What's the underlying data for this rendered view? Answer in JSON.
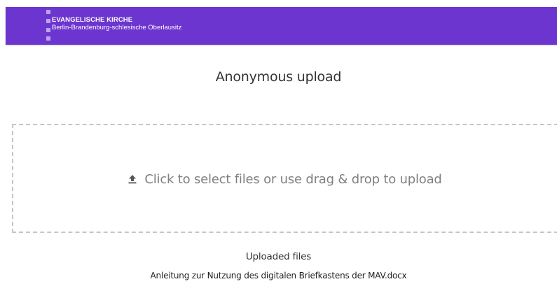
{
  "header": {
    "org_name": "EVANGELISCHE KIRCHE",
    "org_region": "Berlin-Brandenburg-schlesische Oberlausitz",
    "background_color": "#6d35cf"
  },
  "page": {
    "title": "Anonymous upload"
  },
  "dropzone": {
    "icon": "upload-icon",
    "label": "Click to select files or use drag & drop to upload"
  },
  "uploaded": {
    "heading": "Uploaded files",
    "files": [
      {
        "name": "Anleitung zur Nutzung des digitalen Briefkastens der MAV.docx"
      }
    ]
  }
}
